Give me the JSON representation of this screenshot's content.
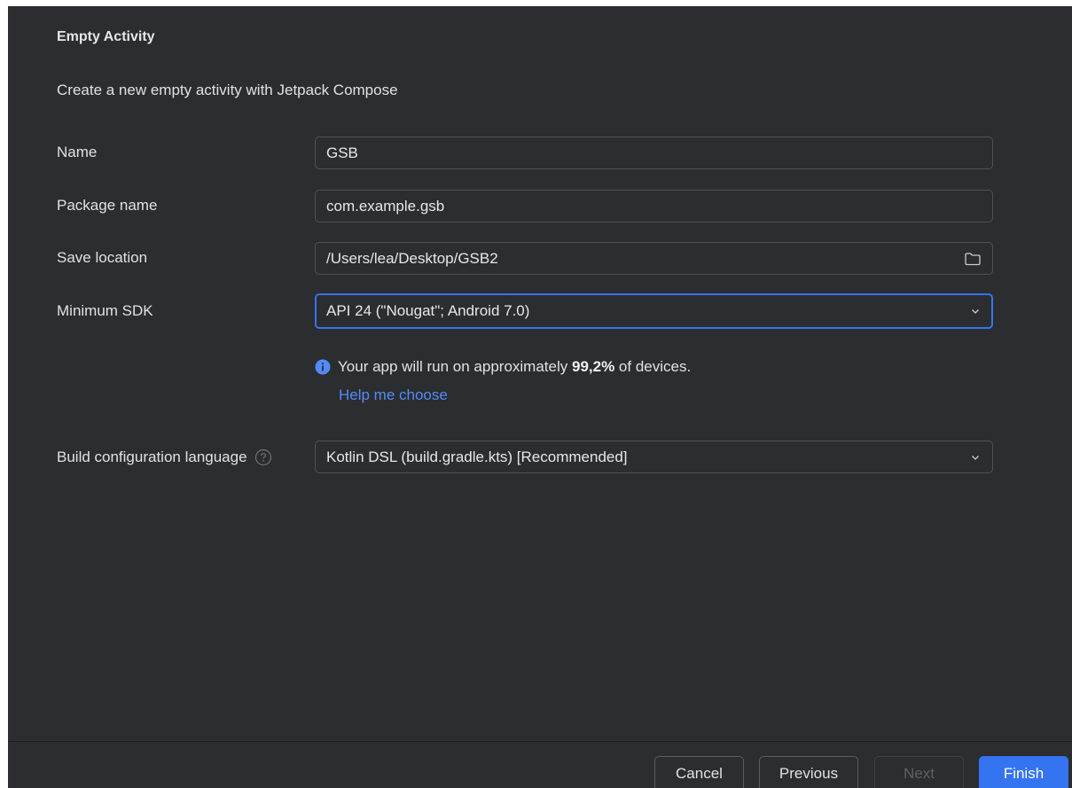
{
  "dialog": {
    "title": "Empty Activity",
    "description": "Create a new empty activity with Jetpack Compose"
  },
  "form": {
    "name": {
      "label": "Name",
      "value": "GSB"
    },
    "package": {
      "label": "Package name",
      "value": "com.example.gsb"
    },
    "save_location": {
      "label": "Save location",
      "value": "/Users/lea/Desktop/GSB2",
      "icon": "folder-icon"
    },
    "min_sdk": {
      "label": "Minimum SDK",
      "selected": "API 24 (\"Nougat\"; Android 7.0)",
      "icon": "chevron-down-icon"
    },
    "info": {
      "icon": "info-icon",
      "text_before": "Your app will run on approximately",
      "percentage": "99,2%",
      "text_after": "of devices.",
      "help_link": "Help me choose"
    },
    "build_language": {
      "label": "Build configuration language",
      "help_icon": "help-circle-icon",
      "selected": "Kotlin DSL (build.gradle.kts) [Recommended]",
      "icon": "chevron-down-icon"
    }
  },
  "footer": {
    "cancel": "Cancel",
    "previous": "Previous",
    "next": "Next",
    "finish": "Finish"
  },
  "colors": {
    "background": "#2b2d30",
    "accent": "#3574f0",
    "link": "#548af7",
    "border": "#4e5157",
    "text": "#dfe1e5"
  }
}
